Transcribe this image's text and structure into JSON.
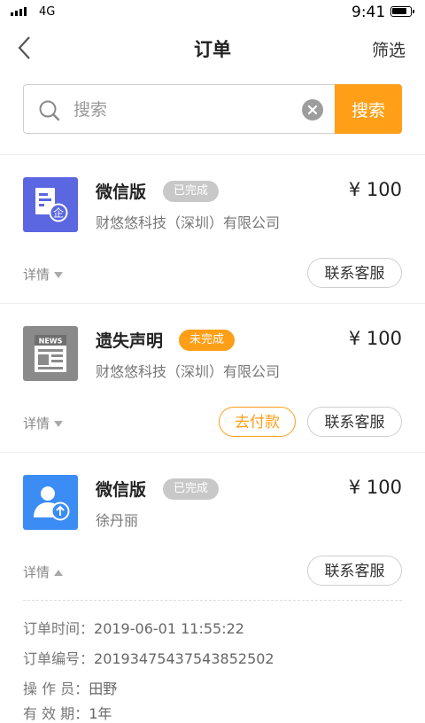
{
  "status_bar": {
    "network": "4G",
    "time": "9:41"
  },
  "nav": {
    "title": "订单",
    "filter_label": "筛选"
  },
  "search": {
    "placeholder": "搜索",
    "button_label": "搜索"
  },
  "orders": [
    {
      "name": "微信版",
      "status": "已完成",
      "company": "财悠悠科技（深圳）有限公司",
      "price": "¥ 100",
      "detail_label": "详情",
      "contact_label": "联系客服",
      "icon": "document-enterprise-icon",
      "accent": "#5b67e0"
    },
    {
      "name": "遗失声明",
      "status": "未完成",
      "company": "财悠悠科技（深圳）有限公司",
      "price": "¥ 100",
      "detail_label": "详情",
      "pay_label": "去付款",
      "contact_label": "联系客服",
      "icon": "news-icon",
      "accent": "#8a8a8a"
    },
    {
      "name": "微信版",
      "status": "已完成",
      "company": "徐丹丽",
      "price": "¥ 100",
      "detail_label": "详情",
      "contact_label": "联系客服",
      "icon": "user-upload-icon",
      "accent": "#3b8cf5",
      "details": [
        {
          "label": "订单时间：",
          "value": "2019-06-01 11:55:22"
        },
        {
          "label": "订单编号：",
          "value": "20193475437543852502"
        },
        {
          "label": "操 作 员：",
          "value": "田野"
        },
        {
          "label": "有 效 期：",
          "value": "1年"
        }
      ]
    }
  ],
  "colors": {
    "accent_orange": "#ff9e17",
    "badge_done": "#c8c8c8"
  }
}
